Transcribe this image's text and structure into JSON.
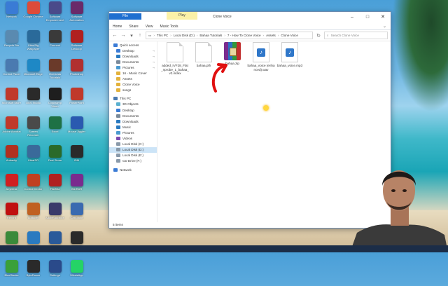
{
  "desktop": {
    "icons": [
      {
        "label": "Network",
        "icon": "network-icon",
        "color": "#3a7bd5"
      },
      {
        "label": "Google Chrome",
        "icon": "chrome-icon",
        "color": "#dd4b39"
      },
      {
        "label": "Software Empowerment",
        "icon": "app-icon",
        "color": "#4a4a8a"
      },
      {
        "label": "Software Automation",
        "icon": "app-icon",
        "color": "#6a2a6a"
      },
      {
        "label": "Recycle Bin",
        "icon": "recycle-bin-icon",
        "color": "#5a8ab0"
      },
      {
        "label": "Ultra Big Wallpaper",
        "icon": "app-icon",
        "color": "#2a6a9a"
      },
      {
        "label": "Connect",
        "icon": "app-icon",
        "color": "#3a3a3a"
      },
      {
        "label": "Software Desktop",
        "icon": "app-icon",
        "color": "#b02020"
      },
      {
        "label": "Control Panel",
        "icon": "control-panel-icon",
        "color": "#4a7ab0"
      },
      {
        "label": "Microsoft Edge",
        "icon": "edge-icon",
        "color": "#1e88c5"
      },
      {
        "label": "Overseas Tutorials",
        "icon": "app-icon",
        "color": "#6a3a2a"
      },
      {
        "label": "Photoshop",
        "icon": "app-icon",
        "color": "#b03030"
      },
      {
        "label": "Microsoft Store",
        "icon": "store-icon",
        "color": "#c0392b"
      },
      {
        "label": "OBS Studio",
        "icon": "obs-icon",
        "color": "#2a2a2a"
      },
      {
        "label": "Clipchamp Video",
        "icon": "app-icon",
        "color": "#1e1e1e"
      },
      {
        "label": "PowerPoint",
        "icon": "app-icon",
        "color": "#c0392b"
      },
      {
        "label": "Adobe Acrobat",
        "icon": "acrobat-icon",
        "color": "#c0392b"
      },
      {
        "label": "Screen Recorder",
        "icon": "app-icon",
        "color": "#4a4a4a"
      },
      {
        "label": "Excel",
        "icon": "excel-icon",
        "color": "#1e7145"
      },
      {
        "label": "Mouse Jiggler",
        "icon": "app-icon",
        "color": "#2a5ab0"
      },
      {
        "label": "Audacity",
        "icon": "audacity-icon",
        "color": "#b03020"
      },
      {
        "label": "UltraISO",
        "icon": "app-icon",
        "color": "#3a6a9a"
      },
      {
        "label": "Fast Stone",
        "icon": "app-icon",
        "color": "#2a6a2a"
      },
      {
        "label": "IDM",
        "icon": "idm-icon",
        "color": "#2a2a2a"
      },
      {
        "label": "AnyDesk",
        "icon": "anydesk-icon",
        "color": "#d02020"
      },
      {
        "label": "Control Center",
        "icon": "app-icon",
        "color": "#c04020"
      },
      {
        "label": "FileZilla",
        "icon": "filezilla-icon",
        "color": "#b02020"
      },
      {
        "label": "WinRAR",
        "icon": "winrar-icon",
        "color": "#7a2b8e"
      },
      {
        "label": "Record",
        "icon": "record-icon",
        "color": "#c01010"
      },
      {
        "label": "Audacity",
        "icon": "app-icon",
        "color": "#c06020"
      },
      {
        "label": "Adobe Audition",
        "icon": "app-icon",
        "color": "#3a3a6a"
      },
      {
        "label": "Calculator",
        "icon": "app-icon",
        "color": "#3a6ab0"
      },
      {
        "label": "Android Studio",
        "icon": "app-icon",
        "color": "#3a8a3a"
      },
      {
        "label": "Keyboard",
        "icon": "app-icon",
        "color": "#2a7ac0"
      },
      {
        "label": "Design",
        "icon": "app-icon",
        "color": "#2a5a9a"
      },
      {
        "label": "Settings",
        "icon": "app-icon",
        "color": "#2a2a2a"
      },
      {
        "label": "BlueStacks",
        "icon": "bluestacks-icon",
        "color": "#3aa03a"
      },
      {
        "label": "ByteDance",
        "icon": "app-icon",
        "color": "#2a2a2a"
      },
      {
        "label": "Settings",
        "icon": "app-icon",
        "color": "#2a4a8a"
      },
      {
        "label": "WhatsApp",
        "icon": "whatsapp-icon",
        "color": "#25d366"
      }
    ]
  },
  "window": {
    "title": "Clone Voice",
    "manage_tab": "Play",
    "ribbon": {
      "file": "File",
      "tabs": [
        "Home",
        "Share",
        "View",
        "Music Tools"
      ]
    },
    "nav_back": "←",
    "nav_forward": "→",
    "nav_up": "↑",
    "breadcrumb": [
      "This PC",
      "Local Disk (D:)",
      "Bahaa Tutorials",
      "7 - How To Clone Voice",
      "Assets",
      "Clone Voice"
    ],
    "search_placeholder": "Search Clone Voice",
    "navpane": [
      {
        "label": "Quick access",
        "type": "head",
        "color": "#3a7bd5"
      },
      {
        "label": "Desktop",
        "type": "sub",
        "color": "#3a7bd5",
        "pin": true
      },
      {
        "label": "Downloads",
        "type": "sub",
        "color": "#2a7ac0",
        "pin": true
      },
      {
        "label": "Documents",
        "type": "sub",
        "color": "#7a8a9a",
        "pin": true
      },
      {
        "label": "Pictures",
        "type": "sub",
        "color": "#4a9ad0",
        "pin": true
      },
      {
        "label": "16 - Music Cover",
        "type": "sub",
        "color": "#e3b23c"
      },
      {
        "label": "Assets",
        "type": "sub",
        "color": "#e3b23c"
      },
      {
        "label": "Clone Voice",
        "type": "sub",
        "color": "#e3b23c"
      },
      {
        "label": "songs",
        "type": "sub",
        "color": "#e3b23c"
      },
      {
        "label": "This PC",
        "type": "head",
        "color": "#4a7ab0"
      },
      {
        "label": "3D Objects",
        "type": "sub",
        "color": "#5ab0d0"
      },
      {
        "label": "Desktop",
        "type": "sub",
        "color": "#3a7bd5"
      },
      {
        "label": "Documents",
        "type": "sub",
        "color": "#7a8a9a"
      },
      {
        "label": "Downloads",
        "type": "sub",
        "color": "#2a7ac0"
      },
      {
        "label": "Music",
        "type": "sub",
        "color": "#2a7ac0"
      },
      {
        "label": "Pictures",
        "type": "sub",
        "color": "#4a9ad0"
      },
      {
        "label": "Videos",
        "type": "sub",
        "color": "#7a4ab0"
      },
      {
        "label": "Local Disk (C:)",
        "type": "sub",
        "color": "#8a9aaa"
      },
      {
        "label": "Local Disk (D:)",
        "type": "sub",
        "color": "#8a9aaa",
        "selected": true
      },
      {
        "label": "Local Disk (E:)",
        "type": "sub",
        "color": "#8a9aaa"
      },
      {
        "label": "CD Drive (F:)",
        "type": "sub",
        "color": "#8a9aaa"
      },
      {
        "label": "Network",
        "type": "head",
        "color": "#3a7bd5"
      }
    ],
    "files": [
      {
        "name": "added_IVF28_Flat_nprobe_1_bahaa_v2.index",
        "kind": "doc"
      },
      {
        "name": "bahaa.pth",
        "kind": "doc"
      },
      {
        "name": "bahaa.zip",
        "kind": "zip"
      },
      {
        "name": "bahaa_voice (enhanced).wav",
        "kind": "audio"
      },
      {
        "name": "bahaa_voice.mp3",
        "kind": "audio"
      }
    ],
    "status": "5 items"
  }
}
